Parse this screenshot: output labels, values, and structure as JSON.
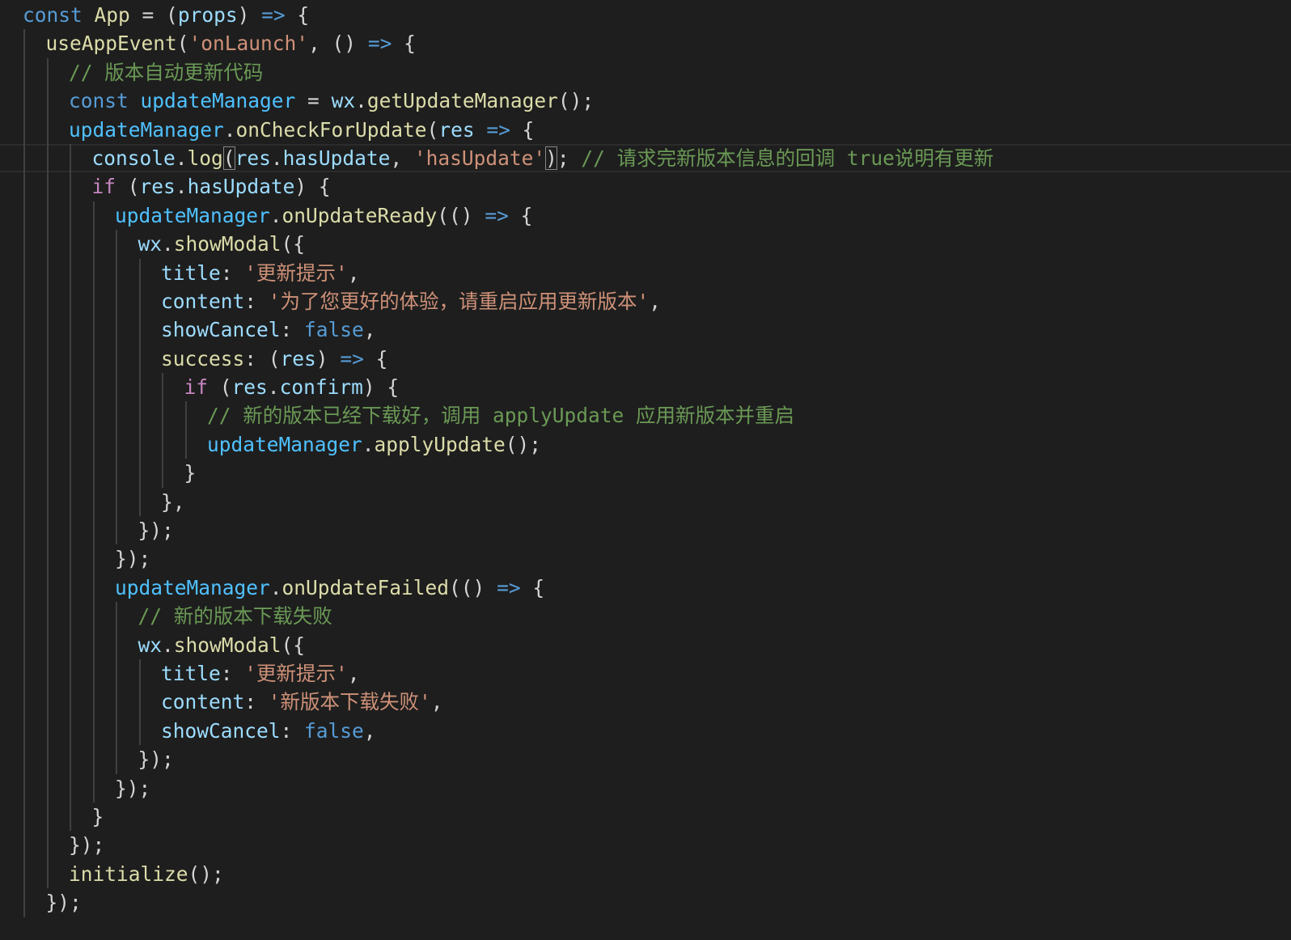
{
  "editor": {
    "language": "javascript",
    "theme": "dark",
    "colors": {
      "background": "#1e1e1e",
      "keyword": "#569cd6",
      "control": "#c586c0",
      "function": "#dcdcaa",
      "variable": "#9cdcfe",
      "constant": "#4fc1ff",
      "string": "#ce9178",
      "comment": "#6a9955",
      "punctuation": "#d4d4d4",
      "indent_guide": "#404040",
      "current_line_border": "#2c2c2c"
    },
    "current_line": 5,
    "matched_brackets_line": 5,
    "lines": [
      {
        "indent": 0,
        "tokens": [
          {
            "t": "keyword",
            "v": "const"
          },
          {
            "t": "punct",
            "v": " "
          },
          {
            "t": "function",
            "v": "App"
          },
          {
            "t": "punct",
            "v": " = ("
          },
          {
            "t": "variable",
            "v": "props"
          },
          {
            "t": "punct",
            "v": ") "
          },
          {
            "t": "keyword",
            "v": "=>"
          },
          {
            "t": "punct",
            "v": " {"
          }
        ]
      },
      {
        "indent": 1,
        "tokens": [
          {
            "t": "function",
            "v": "useAppEvent"
          },
          {
            "t": "punct",
            "v": "("
          },
          {
            "t": "string",
            "v": "'onLaunch'"
          },
          {
            "t": "punct",
            "v": ", () "
          },
          {
            "t": "keyword",
            "v": "=>"
          },
          {
            "t": "punct",
            "v": " {"
          }
        ]
      },
      {
        "indent": 2,
        "tokens": [
          {
            "t": "comment",
            "v": "// 版本自动更新代码"
          }
        ]
      },
      {
        "indent": 2,
        "tokens": [
          {
            "t": "keyword",
            "v": "const"
          },
          {
            "t": "punct",
            "v": " "
          },
          {
            "t": "constant",
            "v": "updateManager"
          },
          {
            "t": "punct",
            "v": " = "
          },
          {
            "t": "variable",
            "v": "wx"
          },
          {
            "t": "punct",
            "v": "."
          },
          {
            "t": "function",
            "v": "getUpdateManager"
          },
          {
            "t": "punct",
            "v": "();"
          }
        ]
      },
      {
        "indent": 2,
        "tokens": [
          {
            "t": "constant",
            "v": "updateManager"
          },
          {
            "t": "punct",
            "v": "."
          },
          {
            "t": "function",
            "v": "onCheckForUpdate"
          },
          {
            "t": "punct",
            "v": "("
          },
          {
            "t": "variable",
            "v": "res"
          },
          {
            "t": "punct",
            "v": " "
          },
          {
            "t": "keyword",
            "v": "=>"
          },
          {
            "t": "punct",
            "v": " {"
          }
        ]
      },
      {
        "indent": 3,
        "tokens": [
          {
            "t": "variable",
            "v": "console"
          },
          {
            "t": "punct",
            "v": "."
          },
          {
            "t": "function",
            "v": "log"
          },
          {
            "t": "bracket",
            "v": "("
          },
          {
            "t": "variable",
            "v": "res"
          },
          {
            "t": "punct",
            "v": "."
          },
          {
            "t": "variable",
            "v": "hasUpdate"
          },
          {
            "t": "punct",
            "v": ", "
          },
          {
            "t": "string",
            "v": "'hasUpdate'"
          },
          {
            "t": "bracket",
            "v": ")"
          },
          {
            "t": "punct",
            "v": "; "
          },
          {
            "t": "comment",
            "v": "// 请求完新版本信息的回调 true说明有更新"
          }
        ]
      },
      {
        "indent": 3,
        "tokens": [
          {
            "t": "control",
            "v": "if"
          },
          {
            "t": "punct",
            "v": " ("
          },
          {
            "t": "variable",
            "v": "res"
          },
          {
            "t": "punct",
            "v": "."
          },
          {
            "t": "variable",
            "v": "hasUpdate"
          },
          {
            "t": "punct",
            "v": ") {"
          }
        ]
      },
      {
        "indent": 4,
        "tokens": [
          {
            "t": "constant",
            "v": "updateManager"
          },
          {
            "t": "punct",
            "v": "."
          },
          {
            "t": "function",
            "v": "onUpdateReady"
          },
          {
            "t": "punct",
            "v": "(() "
          },
          {
            "t": "keyword",
            "v": "=>"
          },
          {
            "t": "punct",
            "v": " {"
          }
        ]
      },
      {
        "indent": 5,
        "tokens": [
          {
            "t": "variable",
            "v": "wx"
          },
          {
            "t": "punct",
            "v": "."
          },
          {
            "t": "function",
            "v": "showModal"
          },
          {
            "t": "punct",
            "v": "({"
          }
        ]
      },
      {
        "indent": 6,
        "tokens": [
          {
            "t": "variable",
            "v": "title"
          },
          {
            "t": "punct",
            "v": ": "
          },
          {
            "t": "string",
            "v": "'更新提示'"
          },
          {
            "t": "punct",
            "v": ","
          }
        ]
      },
      {
        "indent": 6,
        "tokens": [
          {
            "t": "variable",
            "v": "content"
          },
          {
            "t": "punct",
            "v": ": "
          },
          {
            "t": "string",
            "v": "'为了您更好的体验，请重启应用更新版本'"
          },
          {
            "t": "punct",
            "v": ","
          }
        ]
      },
      {
        "indent": 6,
        "tokens": [
          {
            "t": "variable",
            "v": "showCancel"
          },
          {
            "t": "punct",
            "v": ": "
          },
          {
            "t": "keyword",
            "v": "false"
          },
          {
            "t": "punct",
            "v": ","
          }
        ]
      },
      {
        "indent": 6,
        "tokens": [
          {
            "t": "function",
            "v": "success"
          },
          {
            "t": "punct",
            "v": ": ("
          },
          {
            "t": "variable",
            "v": "res"
          },
          {
            "t": "punct",
            "v": ") "
          },
          {
            "t": "keyword",
            "v": "=>"
          },
          {
            "t": "punct",
            "v": " {"
          }
        ]
      },
      {
        "indent": 7,
        "tokens": [
          {
            "t": "control",
            "v": "if"
          },
          {
            "t": "punct",
            "v": " ("
          },
          {
            "t": "variable",
            "v": "res"
          },
          {
            "t": "punct",
            "v": "."
          },
          {
            "t": "variable",
            "v": "confirm"
          },
          {
            "t": "punct",
            "v": ") {"
          }
        ]
      },
      {
        "indent": 8,
        "tokens": [
          {
            "t": "comment",
            "v": "// 新的版本已经下载好，调用 applyUpdate 应用新版本并重启"
          }
        ]
      },
      {
        "indent": 8,
        "tokens": [
          {
            "t": "constant",
            "v": "updateManager"
          },
          {
            "t": "punct",
            "v": "."
          },
          {
            "t": "function",
            "v": "applyUpdate"
          },
          {
            "t": "punct",
            "v": "();"
          }
        ]
      },
      {
        "indent": 7,
        "tokens": [
          {
            "t": "punct",
            "v": "}"
          }
        ]
      },
      {
        "indent": 6,
        "tokens": [
          {
            "t": "punct",
            "v": "},"
          }
        ]
      },
      {
        "indent": 5,
        "tokens": [
          {
            "t": "punct",
            "v": "});"
          }
        ]
      },
      {
        "indent": 4,
        "tokens": [
          {
            "t": "punct",
            "v": "});"
          }
        ]
      },
      {
        "indent": 4,
        "tokens": [
          {
            "t": "constant",
            "v": "updateManager"
          },
          {
            "t": "punct",
            "v": "."
          },
          {
            "t": "function",
            "v": "onUpdateFailed"
          },
          {
            "t": "punct",
            "v": "(() "
          },
          {
            "t": "keyword",
            "v": "=>"
          },
          {
            "t": "punct",
            "v": " {"
          }
        ]
      },
      {
        "indent": 5,
        "tokens": [
          {
            "t": "comment",
            "v": "// 新的版本下载失败"
          }
        ]
      },
      {
        "indent": 5,
        "tokens": [
          {
            "t": "variable",
            "v": "wx"
          },
          {
            "t": "punct",
            "v": "."
          },
          {
            "t": "function",
            "v": "showModal"
          },
          {
            "t": "punct",
            "v": "({"
          }
        ]
      },
      {
        "indent": 6,
        "tokens": [
          {
            "t": "variable",
            "v": "title"
          },
          {
            "t": "punct",
            "v": ": "
          },
          {
            "t": "string",
            "v": "'更新提示'"
          },
          {
            "t": "punct",
            "v": ","
          }
        ]
      },
      {
        "indent": 6,
        "tokens": [
          {
            "t": "variable",
            "v": "content"
          },
          {
            "t": "punct",
            "v": ": "
          },
          {
            "t": "string",
            "v": "'新版本下载失败'"
          },
          {
            "t": "punct",
            "v": ","
          }
        ]
      },
      {
        "indent": 6,
        "tokens": [
          {
            "t": "variable",
            "v": "showCancel"
          },
          {
            "t": "punct",
            "v": ": "
          },
          {
            "t": "keyword",
            "v": "false"
          },
          {
            "t": "punct",
            "v": ","
          }
        ]
      },
      {
        "indent": 5,
        "tokens": [
          {
            "t": "punct",
            "v": "});"
          }
        ]
      },
      {
        "indent": 4,
        "tokens": [
          {
            "t": "punct",
            "v": "});"
          }
        ]
      },
      {
        "indent": 3,
        "tokens": [
          {
            "t": "punct",
            "v": "}"
          }
        ]
      },
      {
        "indent": 2,
        "tokens": [
          {
            "t": "punct",
            "v": "});"
          }
        ]
      },
      {
        "indent": 2,
        "tokens": [
          {
            "t": "function",
            "v": "initialize"
          },
          {
            "t": "punct",
            "v": "();"
          }
        ]
      },
      {
        "indent": 1,
        "tokens": [
          {
            "t": "punct",
            "v": "});"
          }
        ]
      }
    ]
  }
}
